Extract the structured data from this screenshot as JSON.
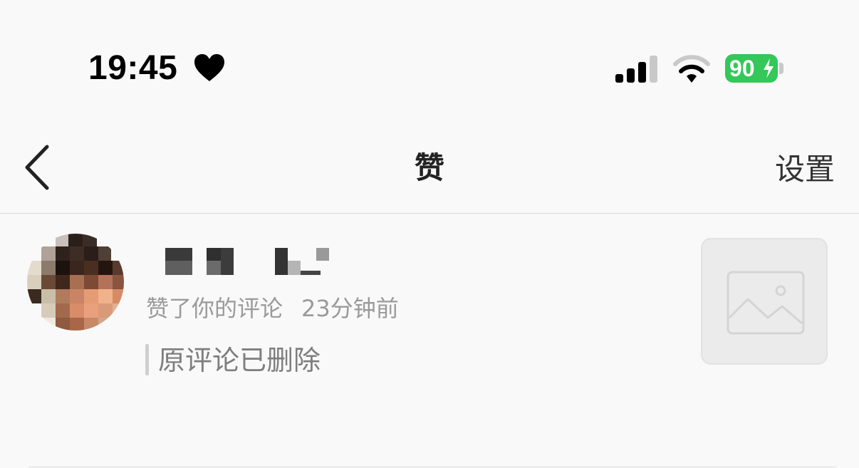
{
  "status_bar": {
    "time": "19:45",
    "battery_level": "90",
    "icons": [
      "heart-icon",
      "cellular-signal-icon",
      "wifi-icon",
      "battery-charging-icon"
    ]
  },
  "nav": {
    "title": "赞",
    "settings_label": "设置",
    "icons": [
      "back-chevron-icon"
    ]
  },
  "notification": {
    "action": "赞了你的评论",
    "time": "23分钟前",
    "quoted_text": "原评论已删除",
    "thumbnail_icon": "image-placeholder-icon"
  },
  "colors": {
    "battery": "#34c759",
    "background": "#f9f9f9",
    "secondary_text": "#9a9a9a"
  }
}
